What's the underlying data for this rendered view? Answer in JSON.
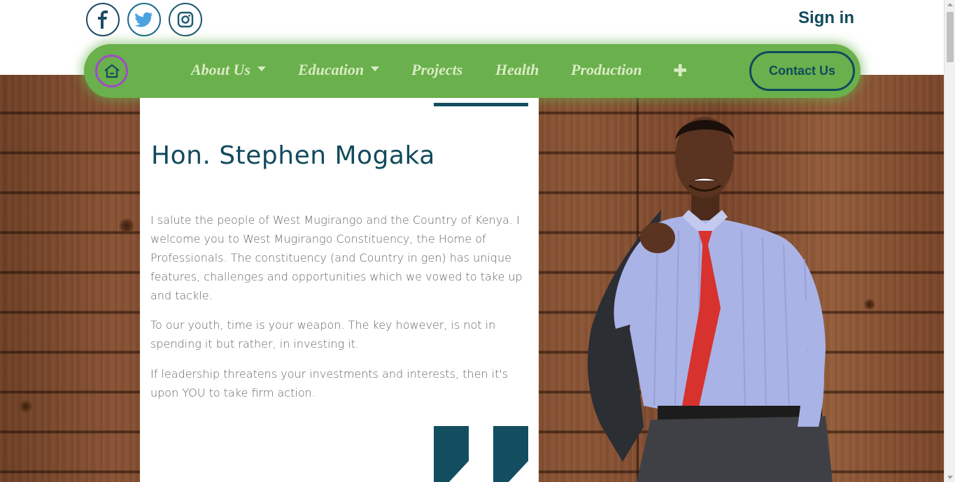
{
  "social": {
    "facebook": {
      "icon": "facebook-icon",
      "color": "#1e4a66"
    },
    "twitter": {
      "icon": "twitter-icon",
      "color": "#4aa3df"
    },
    "instagram": {
      "icon": "instagram-icon",
      "color": "#1e5a6e"
    }
  },
  "header": {
    "signin_label": "Sign in"
  },
  "nav": {
    "home_icon": "home-icon",
    "items": [
      {
        "label": "About Us",
        "dropdown": true
      },
      {
        "label": "Education",
        "dropdown": true
      },
      {
        "label": "Projects",
        "dropdown": false
      },
      {
        "label": "Health",
        "dropdown": false
      },
      {
        "label": "Production",
        "dropdown": false
      }
    ],
    "more_icon": "plus-icon",
    "contact_label": "Contact Us",
    "bg_color": "#6ab04c",
    "accent_color": "#124a5c"
  },
  "intro": {
    "name": "Hon. Stephen Mogaka",
    "paragraphs": [
      "I salute the people of West Mugirango and the Country of Kenya. I welcome you to West Mugirango Constituency, the Home of Professionals. The constituency (and Country in gen) has unique features, challenges and opportunities which we vowed to take up and tackle.",
      "To our youth, time is your weapon. The key however, is not in spending it but rather, in investing it.",
      "If leadership threatens your investments and interests, then it's upon YOU to take firm action."
    ],
    "quote_icon": "quote-mark-icon"
  },
  "portrait": {
    "subject": "portrait-photo"
  }
}
